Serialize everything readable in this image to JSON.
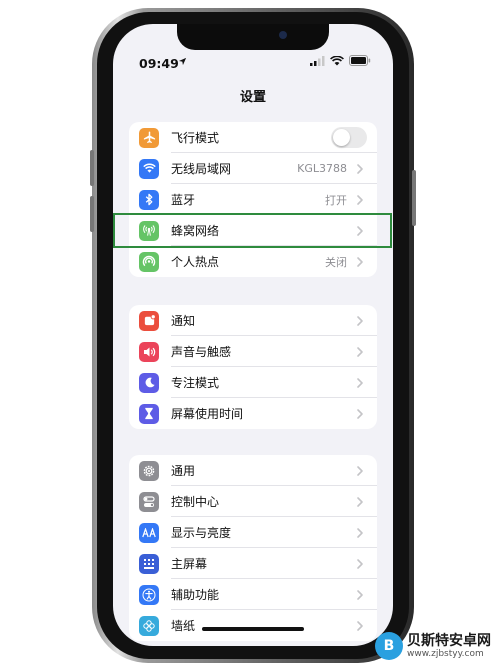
{
  "status_bar": {
    "time": "09:49"
  },
  "page_title": "设置",
  "groups": [
    {
      "items": [
        {
          "label": "飞行模式",
          "value": "",
          "icon": "airplane-icon",
          "color": "#f19a37",
          "type": "toggle"
        },
        {
          "label": "无线局域网",
          "value": "KGL3788",
          "icon": "wifi-icon",
          "color": "#3478f6",
          "type": "link"
        },
        {
          "label": "蓝牙",
          "value": "打开",
          "icon": "bluetooth-icon",
          "color": "#3478f6",
          "type": "link"
        },
        {
          "label": "蜂窝网络",
          "value": "",
          "icon": "cellular-icon",
          "color": "#65c466",
          "type": "link"
        },
        {
          "label": "个人热点",
          "value": "关闭",
          "icon": "hotspot-icon",
          "color": "#65c466",
          "type": "link"
        }
      ]
    },
    {
      "items": [
        {
          "label": "通知",
          "value": "",
          "icon": "notifications-icon",
          "color": "#eb4e3d",
          "type": "link"
        },
        {
          "label": "声音与触感",
          "value": "",
          "icon": "sound-icon",
          "color": "#eb445a",
          "type": "link"
        },
        {
          "label": "专注模式",
          "value": "",
          "icon": "focus-moon-icon",
          "color": "#5e5ce6",
          "type": "link"
        },
        {
          "label": "屏幕使用时间",
          "value": "",
          "icon": "hourglass-icon",
          "color": "#5e5ce6",
          "type": "link"
        }
      ]
    },
    {
      "items": [
        {
          "label": "通用",
          "value": "",
          "icon": "gear-icon",
          "color": "#8e8e93",
          "type": "link"
        },
        {
          "label": "控制中心",
          "value": "",
          "icon": "control-center-icon",
          "color": "#8e8e93",
          "type": "link"
        },
        {
          "label": "显示与亮度",
          "value": "",
          "icon": "display-aa-icon",
          "color": "#3478f6",
          "type": "link"
        },
        {
          "label": "主屏幕",
          "value": "",
          "icon": "home-screen-icon",
          "color": "#3a5fd6",
          "type": "link"
        },
        {
          "label": "辅助功能",
          "value": "",
          "icon": "accessibility-icon",
          "color": "#3478f6",
          "type": "link"
        },
        {
          "label": "墙纸",
          "value": "",
          "icon": "wallpaper-icon",
          "color": "#36aadc",
          "type": "link"
        }
      ]
    }
  ],
  "watermark": {
    "title": "贝斯特安卓网",
    "url": "www.zjbstyy.com"
  }
}
